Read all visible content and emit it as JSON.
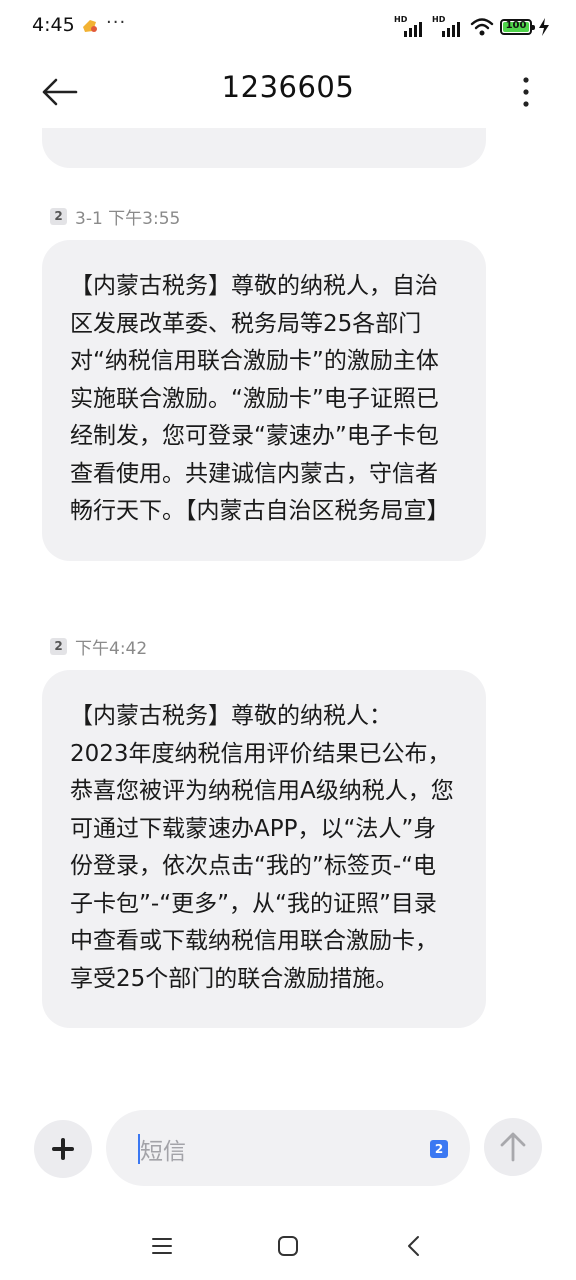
{
  "status_bar": {
    "time": "4:45",
    "overflow": "···",
    "battery": "100",
    "icons": [
      "app-notification-icon",
      "hd-signal-icon",
      "hd-signal-icon",
      "wifi-icon",
      "battery-icon",
      "charging-icon"
    ]
  },
  "header": {
    "title": "1236605",
    "back_icon": "arrow-left-icon",
    "menu_icon": "more-vertical-icon"
  },
  "messages": [
    {
      "sim": "2",
      "time": "3-1 下午3:55",
      "text": "【内蒙古税务】尊敬的纳税人，自治区发展改革委、税务局等25各部门对“纳税信用联合激励卡”的激励主体实施联合激励。“激励卡”电子证照已经制发，您可登录“蒙速办”电子卡包查看使用。共建诚信内蒙古，守信者畅行天下。【内蒙古自治区税务局宣】"
    },
    {
      "sim": "2",
      "time": "下午4:42",
      "text": "【内蒙古税务】尊敬的纳税人：\n2023年度纳税信用评价结果已公布，恭喜您被评为纳税信用A级纳税人，您可通过下载蒙速办APP，以“法人”身份登录，依次点击“我的”标签页-“电子卡包”-“更多”，从“我的证照”目录中查看或下载纳税信用联合激励卡，享受25个部门的联合激励措施。"
    }
  ],
  "composer": {
    "placeholder": "短信",
    "sim": "2",
    "add_icon": "plus-icon",
    "send_icon": "arrow-up-icon"
  },
  "nav_bar": {
    "icons": [
      "menu-icon",
      "home-square-icon",
      "back-chevron-icon"
    ]
  },
  "colors": {
    "bubble": "#f1f1f3",
    "accent": "#3b78f2",
    "timestamp": "#8a8a8a"
  }
}
